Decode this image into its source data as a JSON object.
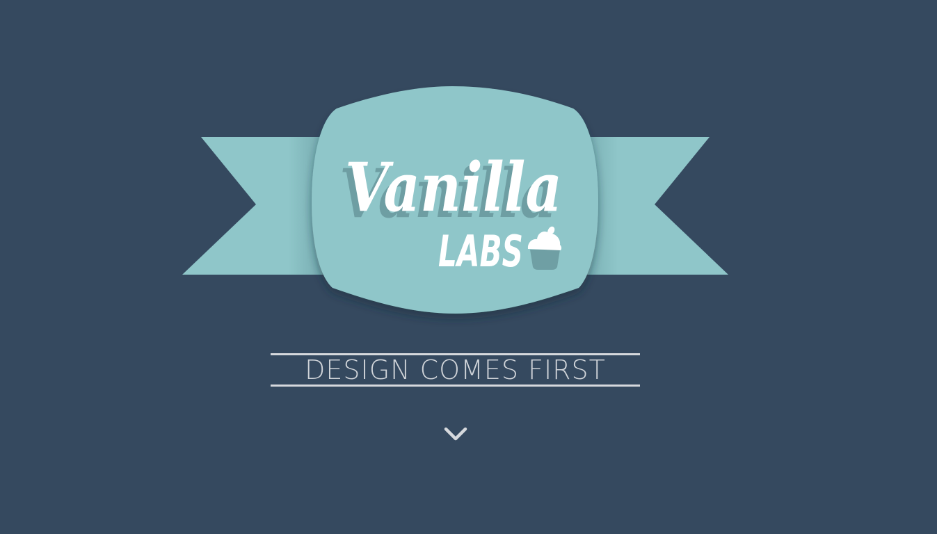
{
  "logo": {
    "brand_script": "Vanilla",
    "brand_sub": "LABS",
    "icon": "cupcake-icon",
    "colors": {
      "background": "#35495f",
      "badge": "#8fc6c9",
      "ribbon_shadow": "#7aaeb2",
      "text": "#ffffff",
      "text_shadow": "#6e9ea3",
      "cupcake": "#6f9fa4"
    }
  },
  "tagline": {
    "text": "DESIGN COMES FIRST"
  },
  "scroll": {
    "icon": "chevron-down-icon"
  }
}
